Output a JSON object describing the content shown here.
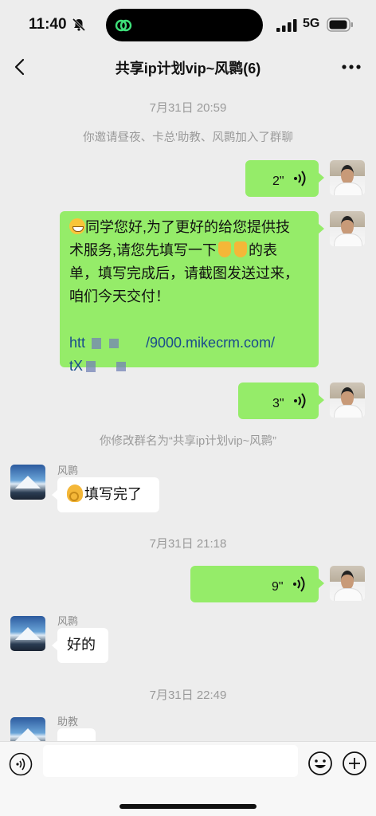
{
  "status": {
    "time": "11:40",
    "network": "5G",
    "icons": [
      "bell-slash-icon",
      "wechat-link-icon",
      "signal-icon",
      "battery-icon"
    ]
  },
  "nav": {
    "title": "共享ip计划vip~风鹮(6)",
    "back_icon": "chevron-left-icon",
    "more_icon": "more-dots-icon"
  },
  "messages": {
    "ts1": "7月31日 20:59",
    "sys_invite": "你邀请昼夜、卡总'助教、风鹮加入了群聊",
    "voice1_duration": "2\"",
    "text1_line1": "同学您好,为了更好的给您提供技",
    "text1_line2": "术服务,请您先填写一下",
    "text1_line2_end": "的表",
    "text1_line3": "单，填写完成后，请截图发送过来，",
    "text1_line4": "咱们今天交付！",
    "link_start": "htt",
    "link_end": "/9000.mikecrm.com/",
    "link_line2": "tX",
    "voice2_duration": "3\"",
    "sys_rename": "你修改群名为“共享ip计划vip~风鹮”",
    "peer1_name": "风鹮",
    "peer1_text": "填写完了",
    "ts2": "7月31日 21:18",
    "voice3_duration": "9\"",
    "peer2_name": "风鹮",
    "peer2_text": "好的",
    "ts3": "7月31日 22:49",
    "peer3_name": "助教"
  },
  "input": {
    "placeholder": "",
    "icons": [
      "voice-toggle-icon",
      "emoji-icon",
      "plus-icon"
    ]
  },
  "colors": {
    "bubble_green": "#95ec69",
    "background": "#ededed"
  }
}
